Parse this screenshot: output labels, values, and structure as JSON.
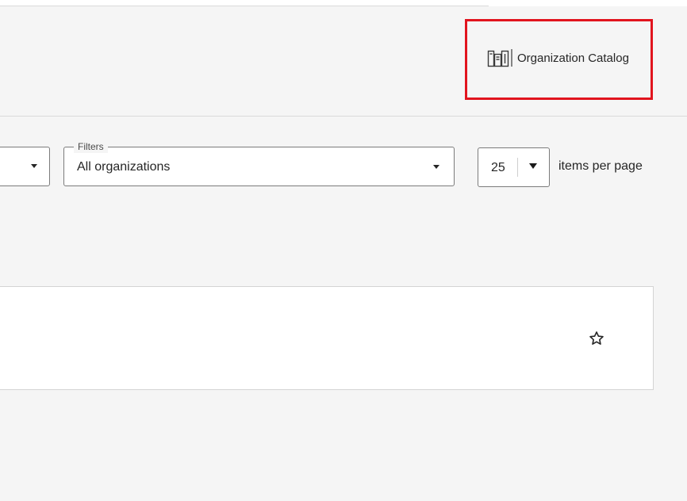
{
  "header": {
    "catalog_link": {
      "label": "Organization Catalog",
      "icon": "catalog-books-icon"
    }
  },
  "toolbar": {
    "sort_select": {
      "value": ""
    },
    "filters": {
      "label": "Filters",
      "value": "All organizations"
    },
    "pagination": {
      "page_size": "25",
      "suffix": "items per page"
    }
  },
  "results": [
    {
      "favorite_icon": "star-outline-icon"
    }
  ],
  "colors": {
    "highlight": "#e1141e",
    "background": "#f5f5f5",
    "card": "#ffffff",
    "border": "#7b7b7b"
  }
}
